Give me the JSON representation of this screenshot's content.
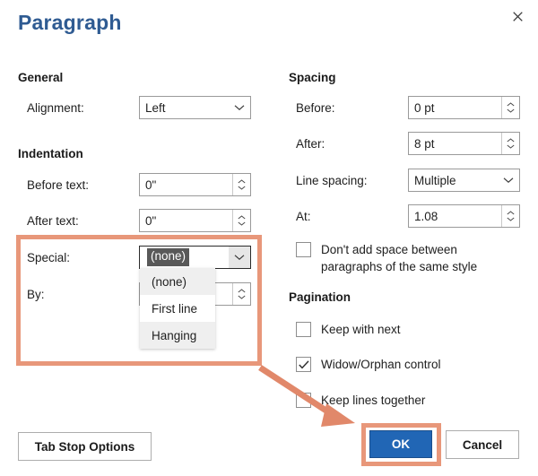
{
  "dialog": {
    "title": "Paragraph",
    "close_icon": "close-icon"
  },
  "general": {
    "heading": "General",
    "alignment": {
      "label": "Alignment:",
      "value": "Left",
      "icon": "chevron-down-icon"
    }
  },
  "indentation": {
    "heading": "Indentation",
    "before_text": {
      "label": "Before text:",
      "value": "0\""
    },
    "after_text": {
      "label": "After text:",
      "value": "0\""
    },
    "special": {
      "label": "Special:",
      "value": "(none)",
      "icon": "chevron-down-icon",
      "options": [
        "(none)",
        "First line",
        "Hanging"
      ],
      "hovered_option": "First line"
    },
    "by": {
      "label": "By:",
      "value": ""
    }
  },
  "spacing": {
    "heading": "Spacing",
    "before": {
      "label": "Before:",
      "value": "0 pt"
    },
    "after": {
      "label": "After:",
      "value": "8 pt"
    },
    "line_spacing": {
      "label": "Line spacing:",
      "value": "Multiple",
      "icon": "chevron-down-icon"
    },
    "at": {
      "label": "At:",
      "value": "1.08"
    },
    "dont_add_space": {
      "label_line1": "Don't add space between",
      "label_line2": "paragraphs of the same style",
      "checked": false
    }
  },
  "pagination": {
    "heading": "Pagination",
    "items": [
      {
        "label": "Keep with next",
        "checked": false
      },
      {
        "label": "Widow/Orphan control",
        "checked": true
      },
      {
        "label": "Keep lines together",
        "checked": false
      }
    ]
  },
  "footer": {
    "tab_stop_options": "Tab Stop Options",
    "ok": "OK",
    "cancel": "Cancel"
  },
  "annotations": {
    "highlight_color": "#e8977a",
    "arrow_color": "#e1886a"
  }
}
